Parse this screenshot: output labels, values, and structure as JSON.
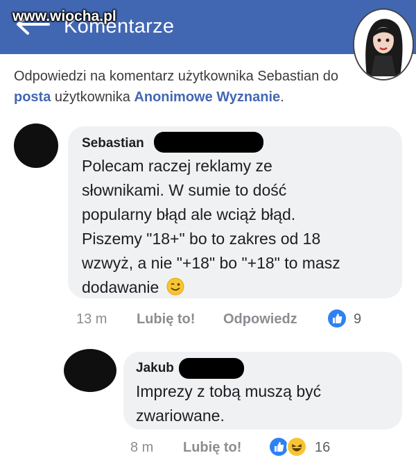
{
  "header": {
    "title": "Komentarze",
    "watermark": "www.wiocha.pl"
  },
  "context": {
    "prefix": "Odpowiedzi na komentarz użytkownika Sebastian do",
    "link1": "posta",
    "middle": "użytkownika",
    "link2": "Anonimowe Wyznanie",
    "suffix": "."
  },
  "comments": [
    {
      "author": "Sebastian",
      "lines": [
        "Polecam raczej reklamy ze",
        "słownikami. W sumie to dość",
        "popularny błąd ale wciąż błąd.",
        "Piszemy \"18+\" bo to zakres od 18",
        "wzwyż, a nie \"+18\" bo \"+18\" to masz",
        "dodawanie"
      ],
      "time": "13 m",
      "like_label": "Lubię to!",
      "reply_label": "Odpowiedz",
      "reaction_count": "9"
    },
    {
      "author": "Jakub",
      "lines": [
        "Imprezy z tobą muszą być",
        "zwariowane."
      ],
      "time": "8 m",
      "like_label": "Lubię to!",
      "reaction_count": "16"
    }
  ],
  "colors": {
    "header_bg": "#4267b2",
    "link": "#4267b2",
    "bubble": "#f0f1f3",
    "like_blue": "#2e81f4",
    "haha_yellow": "#f7c433"
  }
}
